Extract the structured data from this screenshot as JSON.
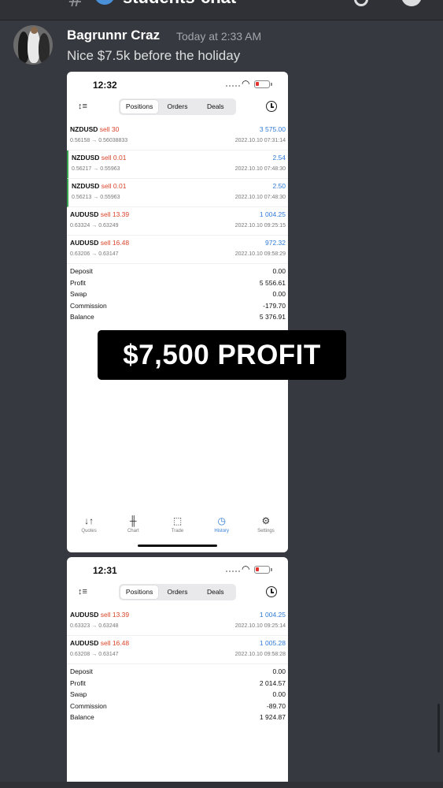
{
  "header": {
    "channel_name": "students-chat",
    "hash": "#"
  },
  "message": {
    "author": "Bagrunnr Craz",
    "timestamp": "Today at 2:33 AM",
    "text": "Nice $7.5k before the holiday"
  },
  "overlay": {
    "text": "$7,500 PROFIT"
  },
  "screenshot1": {
    "time": "12:32",
    "tabs": [
      "Positions",
      "Orders",
      "Deals"
    ],
    "active_tab": "Positions",
    "trades": [
      {
        "symbol": "NZDUSD",
        "side": "sell 30",
        "profit": "3 575.00",
        "prices": "0.56158 → 0.56038833",
        "datetime": "2022.10.10 07:31:14",
        "marked": false
      },
      {
        "symbol": "NZDUSD",
        "side": "sell 0.01",
        "profit": "2.54",
        "prices": "0.56217 → 0.55963",
        "datetime": "2022.10.10 07:48:30",
        "marked": true
      },
      {
        "symbol": "NZDUSD",
        "side": "sell 0.01",
        "profit": "2.50",
        "prices": "0.56213 → 0.55963",
        "datetime": "2022.10.10 07:48:30",
        "marked": true
      },
      {
        "symbol": "AUDUSD",
        "side": "sell 13.39",
        "profit": "1 004.25",
        "prices": "0.63324 → 0.63249",
        "datetime": "2022.10.10 09:25:15",
        "marked": false
      },
      {
        "symbol": "AUDUSD",
        "side": "sell 16.48",
        "profit": "972.32",
        "prices": "0.63206 → 0.63147",
        "datetime": "2022.10.10 09:58:29",
        "marked": false
      }
    ],
    "summary": [
      {
        "label": "Deposit",
        "value": "0.00"
      },
      {
        "label": "Profit",
        "value": "5 556.61"
      },
      {
        "label": "Swap",
        "value": "0.00"
      },
      {
        "label": "Commission",
        "value": "-179.70"
      },
      {
        "label": "Balance",
        "value": "5 376.91"
      }
    ],
    "nav": [
      {
        "label": "Quotes",
        "icon": "quotes-icon",
        "glyph": "↓↑"
      },
      {
        "label": "Chart",
        "icon": "chart-icon",
        "glyph": "╫"
      },
      {
        "label": "Trade",
        "icon": "trade-icon",
        "glyph": "⬚"
      },
      {
        "label": "History",
        "icon": "history-icon",
        "glyph": "◷"
      },
      {
        "label": "Settings",
        "icon": "settings-icon",
        "glyph": "⚙"
      }
    ],
    "active_nav": "History"
  },
  "screenshot2": {
    "time": "12:31",
    "tabs": [
      "Positions",
      "Orders",
      "Deals"
    ],
    "active_tab": "Positions",
    "trades": [
      {
        "symbol": "AUDUSD",
        "side": "sell 13.39",
        "profit": "1 004.25",
        "prices": "0.63323 → 0.63248",
        "datetime": "2022.10.10 09:25:14",
        "marked": false
      },
      {
        "symbol": "AUDUSD",
        "side": "sell 16.48",
        "profit": "1 005.28",
        "prices": "0.63208 → 0.63147",
        "datetime": "2022.10.10 09:58:28",
        "marked": false
      }
    ],
    "summary": [
      {
        "label": "Deposit",
        "value": "0.00"
      },
      {
        "label": "Profit",
        "value": "2 014.57"
      },
      {
        "label": "Swap",
        "value": "0.00"
      },
      {
        "label": "Commission",
        "value": "-89.70"
      },
      {
        "label": "Balance",
        "value": "1 924.87"
      }
    ]
  },
  "colors": {
    "background": "#36393f",
    "sell": "#d9452b",
    "profit": "#2f7bd6",
    "marker": "#3aa651"
  }
}
